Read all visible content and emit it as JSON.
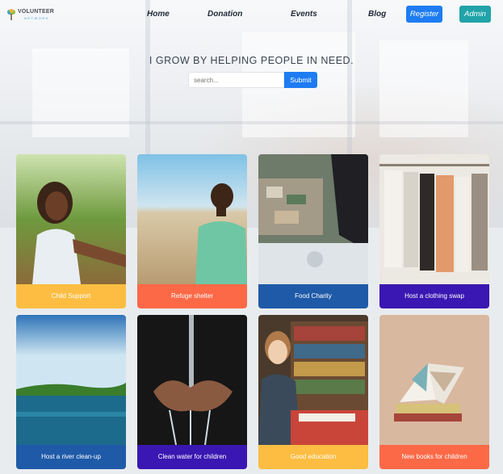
{
  "brand": {
    "name": "VOLUNTEER",
    "sub": "NETWORK"
  },
  "nav": {
    "links": [
      "Home",
      "Donation",
      "Events",
      "Blog"
    ],
    "register_label": "Register",
    "admin_label": "Admin"
  },
  "hero": {
    "tagline": "I GROW BY HELPING PEOPLE IN NEED.",
    "search_placeholder": "search...",
    "submit_label": "Submit"
  },
  "colors": {
    "primary": "#1e7cf2",
    "teal": "#20a3a9",
    "yellow": "#fcbd42",
    "orange": "#fc6947",
    "blue": "#1f5aa8",
    "purple": "#3a17b2"
  },
  "cards": [
    {
      "title": "Child Support",
      "color": "#fcbd42"
    },
    {
      "title": "Refuge shelter",
      "color": "#fc6947"
    },
    {
      "title": "Food Charity",
      "color": "#1f5aa8"
    },
    {
      "title": "Host a clothing swap",
      "color": "#3a17b2"
    },
    {
      "title": "Host a river clean-up",
      "color": "#1f5aa8"
    },
    {
      "title": "Clean water for children",
      "color": "#3a17b2"
    },
    {
      "title": "Good education",
      "color": "#fcbd42"
    },
    {
      "title": "New books for children",
      "color": "#fc6947"
    }
  ]
}
